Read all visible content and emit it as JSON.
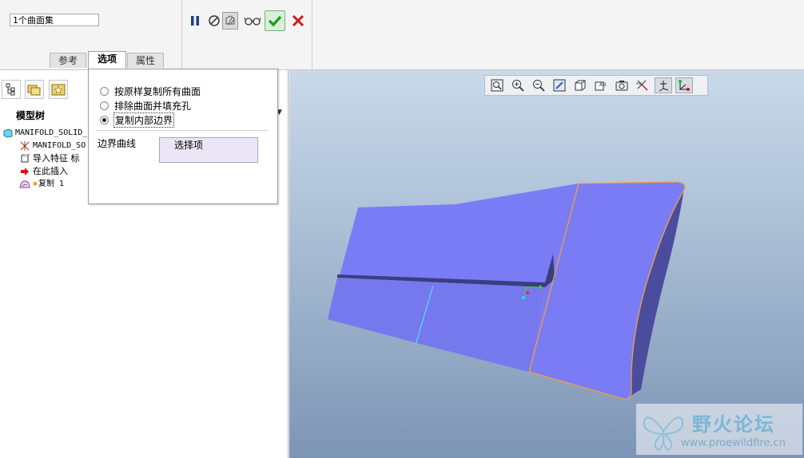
{
  "dashboard": {
    "collector_value": "1个曲面集",
    "tabs": [
      {
        "label": "参考"
      },
      {
        "label": "选项"
      },
      {
        "label": "属性"
      }
    ],
    "active_tab": "选项",
    "toolbar": {
      "pause_icon": "pause-icon",
      "no_preview_icon": "no-preview-icon",
      "preview_icon": "preview-icon",
      "glasses_icon": "glasses-icon",
      "ok_icon": "checkmark-icon",
      "cancel_icon": "cancel-x-icon"
    }
  },
  "options_panel": {
    "radios": [
      {
        "label": "按原样复制所有曲面",
        "checked": false
      },
      {
        "label": "排除曲面并填充孔",
        "checked": false
      },
      {
        "label": "复制内部边界",
        "checked": true
      }
    ],
    "boundary_label": "边界曲线",
    "select_placeholder": "选择项"
  },
  "model_tree": {
    "title": "模型树",
    "items": [
      {
        "icon": "part-icon",
        "text": "MANIFOLD_SOLID_"
      },
      {
        "icon": "csys-icon",
        "text": "MANIFOLD_SO"
      },
      {
        "icon": "import-feature-icon",
        "text": "导入特征 标"
      },
      {
        "icon": "insert-here-arrow-icon",
        "text": "在此插入"
      },
      {
        "icon": "copy-surface-icon",
        "text": "复制 1"
      }
    ]
  },
  "viewport_toolbar": [
    {
      "icon": "zoom-refit-icon",
      "on": false
    },
    {
      "icon": "zoom-in-icon",
      "on": false
    },
    {
      "icon": "zoom-out-icon",
      "on": false
    },
    {
      "icon": "repaint-icon",
      "on": false
    },
    {
      "icon": "display-style-icon",
      "on": false
    },
    {
      "icon": "saved-views-icon",
      "on": false
    },
    {
      "icon": "view-manager-icon",
      "on": false
    },
    {
      "icon": "datum-display-icon",
      "on": false
    },
    {
      "icon": "csys-display-icon",
      "on": true
    },
    {
      "icon": "spin-center-icon",
      "on": true
    }
  ],
  "watermark": {
    "title": "野火论坛",
    "url": "www.proewildfire.cn"
  },
  "colors": {
    "surface": "#7a7cf5",
    "surface_dark": "#4a4d9e",
    "edge": "#f0a040",
    "ok_green": "#19a019",
    "cancel_red": "#d01818"
  }
}
